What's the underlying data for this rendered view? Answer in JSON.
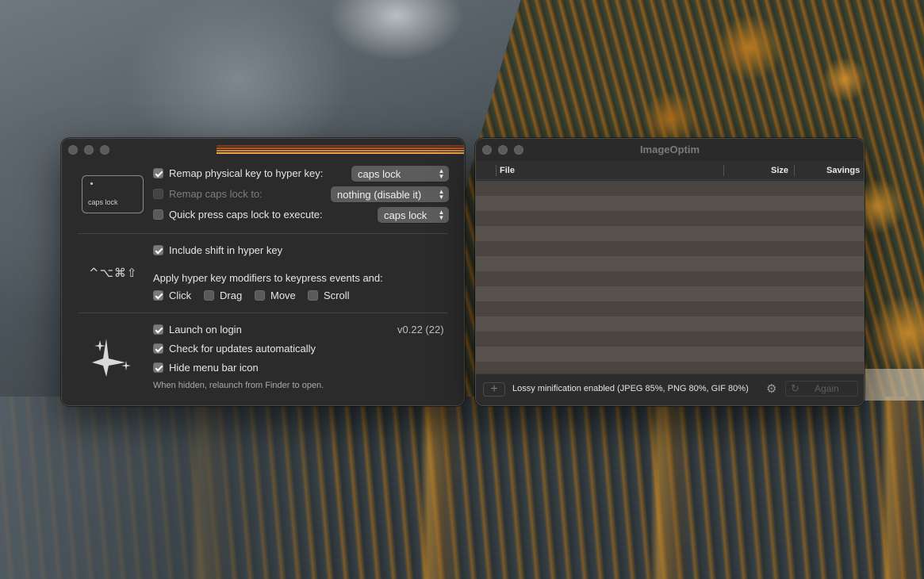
{
  "hyperkey": {
    "keycap_label": "caps lock",
    "remap_label": "Remap physical key to hyper key:",
    "remap_value": "caps lock",
    "remap_checked": true,
    "remap_caps_label": "Remap caps lock to:",
    "remap_caps_value": "nothing (disable it)",
    "quick_press_label": "Quick press caps lock to execute:",
    "quick_press_value": "caps lock",
    "modifier_symbols": "^⌥⌘⇧",
    "include_shift_label": "Include shift in hyper key",
    "apply_label": "Apply hyper key modifiers to keypress events and:",
    "events": [
      {
        "label": "Click",
        "checked": true
      },
      {
        "label": "Drag",
        "checked": false
      },
      {
        "label": "Move",
        "checked": false
      },
      {
        "label": "Scroll",
        "checked": false
      }
    ],
    "launch_label": "Launch on login",
    "version": "v0.22 (22)",
    "updates_label": "Check for updates automatically",
    "hide_icon_label": "Hide menu bar icon",
    "hidden_note": "When hidden, relaunch from Finder to open.",
    "stripe_colors": [
      "#7a3e1a",
      "#b8561f",
      "#d9822b",
      "#e9a94a",
      "#f2cf8a"
    ]
  },
  "imageoptim": {
    "title": "ImageOptim",
    "columns": {
      "file": "File",
      "size": "Size",
      "savings": "Savings"
    },
    "status": "Lossy minification enabled (JPEG 85%, PNG 80%, GIF 80%)",
    "again_label": "Again",
    "add_symbol": "+",
    "gear_symbol": "⚙",
    "reload_symbol": "↻"
  }
}
